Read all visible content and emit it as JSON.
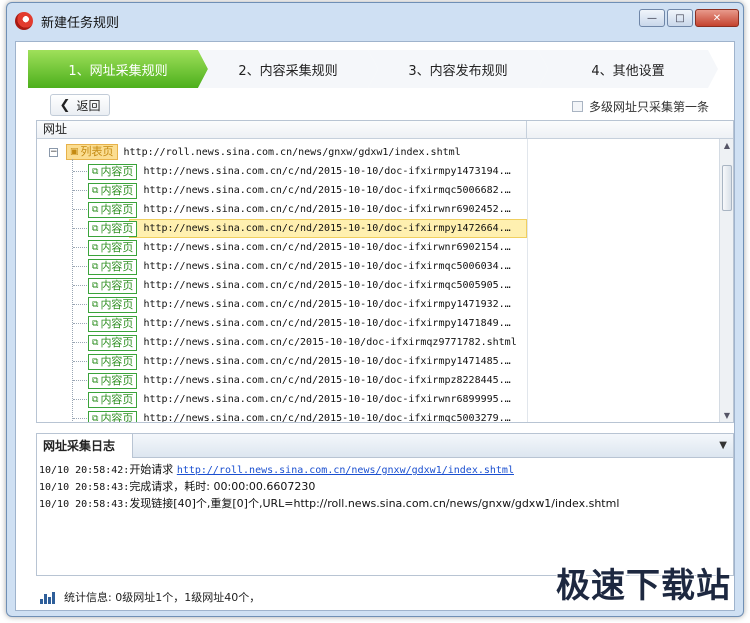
{
  "window": {
    "title": "新建任务规则",
    "controls": {
      "minimize": "—",
      "maximize": "□",
      "close": "✕"
    }
  },
  "steps": [
    {
      "label": "1、网址采集规则",
      "active": true
    },
    {
      "label": "2、内容采集规则",
      "active": false
    },
    {
      "label": "3、内容发布规则",
      "active": false
    },
    {
      "label": "4、其他设置",
      "active": false
    }
  ],
  "toolbar": {
    "back_label": "返回",
    "only_first_label": "多级网址只采集第一条",
    "only_first_checked": false
  },
  "tree": {
    "column_header": "网址",
    "root": {
      "tag": "列表页",
      "url": "http://roll.news.sina.com.cn/news/gnxw/gdxw1/index.shtml",
      "expander": "−"
    },
    "children": [
      {
        "tag": "内容页",
        "url": "http://news.sina.com.cn/c/nd/2015-10-10/doc-ifxirmpy1473194.…"
      },
      {
        "tag": "内容页",
        "url": "http://news.sina.com.cn/c/nd/2015-10-10/doc-ifxirmqc5006682.…"
      },
      {
        "tag": "内容页",
        "url": "http://news.sina.com.cn/c/nd/2015-10-10/doc-ifxirwnr6902452.…"
      },
      {
        "tag": "内容页",
        "url": "http://news.sina.com.cn/c/nd/2015-10-10/doc-ifxirmpy1472664.…",
        "selected": true
      },
      {
        "tag": "内容页",
        "url": "http://news.sina.com.cn/c/nd/2015-10-10/doc-ifxirwnr6902154.…"
      },
      {
        "tag": "内容页",
        "url": "http://news.sina.com.cn/c/nd/2015-10-10/doc-ifxirmqc5006034.…"
      },
      {
        "tag": "内容页",
        "url": "http://news.sina.com.cn/c/nd/2015-10-10/doc-ifxirmqc5005905.…"
      },
      {
        "tag": "内容页",
        "url": "http://news.sina.com.cn/c/nd/2015-10-10/doc-ifxirmpy1471932.…"
      },
      {
        "tag": "内容页",
        "url": "http://news.sina.com.cn/c/nd/2015-10-10/doc-ifxirmpy1471849.…"
      },
      {
        "tag": "内容页",
        "url": "http://news.sina.com.cn/c/2015-10-10/doc-ifxirmqz9771782.shtml"
      },
      {
        "tag": "内容页",
        "url": "http://news.sina.com.cn/c/nd/2015-10-10/doc-ifxirmpy1471485.…"
      },
      {
        "tag": "内容页",
        "url": "http://news.sina.com.cn/c/nd/2015-10-10/doc-ifxirmpz8228445.…"
      },
      {
        "tag": "内容页",
        "url": "http://news.sina.com.cn/c/nd/2015-10-10/doc-ifxirwnr6899995.…"
      },
      {
        "tag": "内容页",
        "url": "http://news.sina.com.cn/c/nd/2015-10-10/doc-ifxirmqc5003279.…"
      }
    ]
  },
  "log": {
    "tab_label": "网址采集日志",
    "lines": [
      {
        "time": "10/10 20:58:42:",
        "text": "开始请求 ",
        "link": "http://roll.news.sina.com.cn/news/gnxw/gdxw1/index.shtml"
      },
      {
        "time": "10/10 20:58:43:",
        "text": "完成请求，耗时: 00:00:00.6607230",
        "link": ""
      },
      {
        "time": "10/10 20:58:43:",
        "text": "发现链接[40]个,重复[0]个,URL=http://roll.news.sina.com.cn/news/gnxw/gdxw1/index.shtml",
        "link": ""
      }
    ]
  },
  "status": {
    "text": "统计信息: 0级网址1个，1级网址40个，"
  },
  "watermark": "极速下载站",
  "colors": {
    "active_step": "#4caf1c",
    "list_tag_bg": "#fbdd91",
    "content_tag_border": "#3aa33a",
    "selected_row": "#fff0b0",
    "link": "#1a4fd0"
  }
}
